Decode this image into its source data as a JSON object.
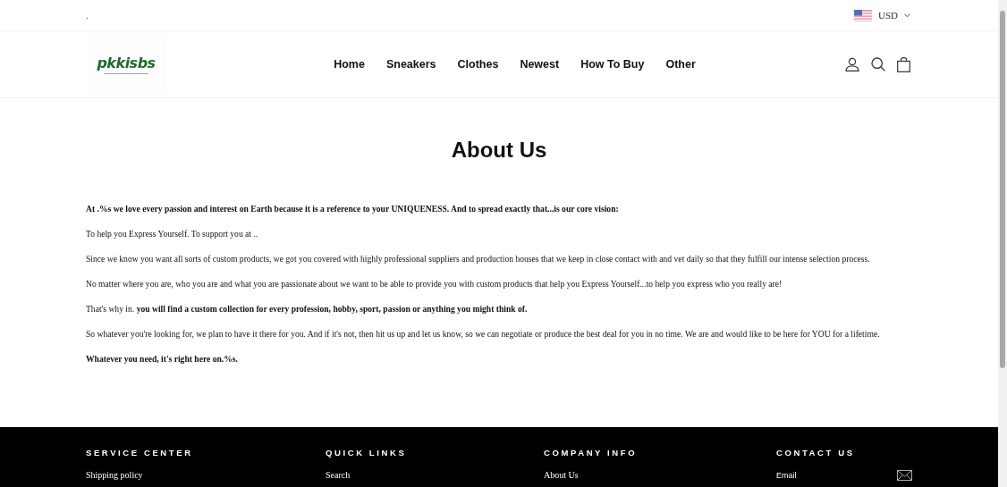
{
  "announcement": ".",
  "currency": {
    "code": "USD"
  },
  "logo": {
    "text": "pkkisbs"
  },
  "nav": [
    {
      "label": "Home"
    },
    {
      "label": "Sneakers"
    },
    {
      "label": "Clothes"
    },
    {
      "label": "Newest"
    },
    {
      "label": "How To Buy"
    },
    {
      "label": "Other"
    }
  ],
  "page_title": "About Us",
  "paragraphs": [
    {
      "text": "At .%s we love every passion and interest on Earth because it is a reference to your UNIQUENESS. And to spread exactly that...is our core vision:",
      "bold": true
    },
    {
      "text": "To help you Express Yourself. To support you at ..",
      "bold": false
    },
    {
      "text": "Since we know you want all sorts of custom products, we got you covered with highly professional suppliers and production houses that we keep in close contact with and vet daily so that they fulfill our intense selection process.",
      "bold": false
    },
    {
      "text": "No matter where you are, who you are and what you are passionate about we want to be able to provide you with custom products that help you Express Yourself...to help you express who you really are!",
      "bold": false
    },
    {
      "text": "That's why in. **you will find a custom collection for every profession, hobby, sport, passion or anything you might think of.**",
      "bold": false
    },
    {
      "text": "So whatever you're looking for, we plan to have it there for you. And if it's not, then hit us up and let us know, so we can negotiate or produce the best deal for you in no time. We are and would like to be here for YOU for a lifetime.",
      "bold": false
    },
    {
      "text": "Whatever you need, it's right here on.%s.",
      "bold": true
    }
  ],
  "footer": [
    {
      "heading": "SERVICE CENTER",
      "kind": "links",
      "links": [
        "Shipping policy"
      ]
    },
    {
      "heading": "QUICK LINKS",
      "kind": "links",
      "links": [
        "Search"
      ]
    },
    {
      "heading": "COMPANY INFO",
      "kind": "links",
      "links": [
        "About Us"
      ]
    },
    {
      "heading": "CONTACT US",
      "kind": "email",
      "placeholder": "Email"
    }
  ]
}
